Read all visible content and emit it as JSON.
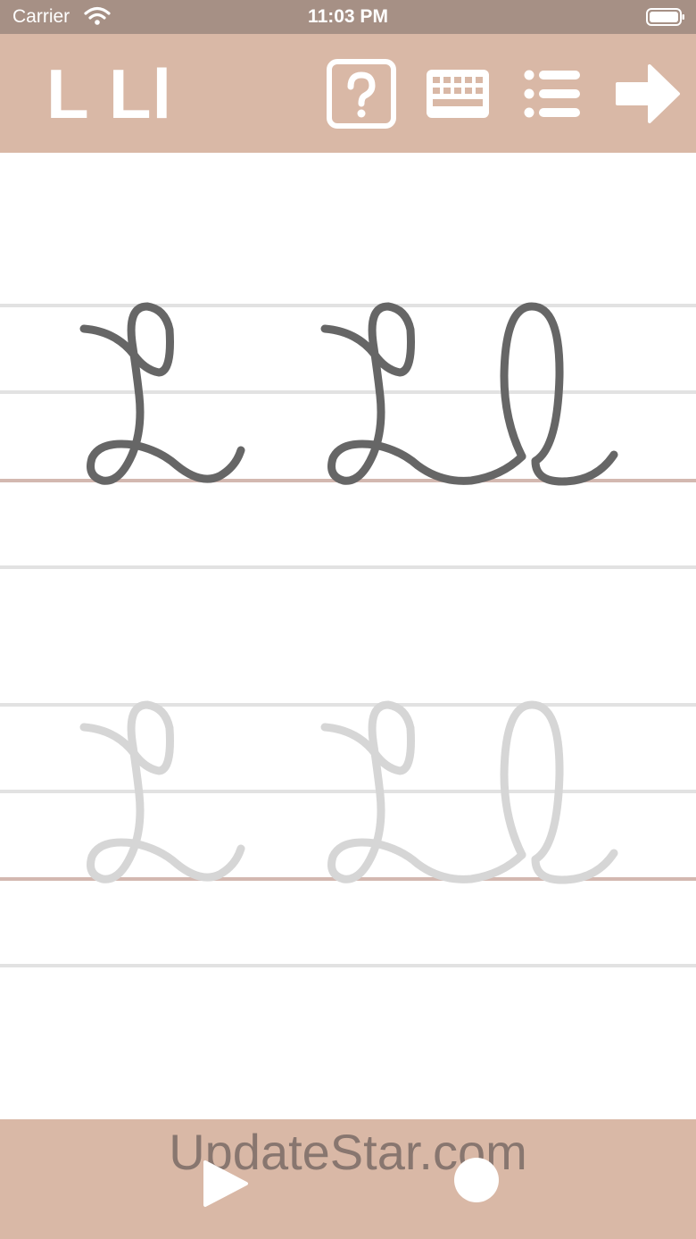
{
  "status_bar": {
    "carrier": "Carrier",
    "time": "11:03 PM"
  },
  "top_bar": {
    "title": "L Ll",
    "icons": [
      "help-icon",
      "keyboard-icon",
      "list-icon",
      "arrow-right-icon"
    ]
  },
  "practice": {
    "example_letters": "L Ll",
    "trace_letters": "L Ll",
    "colors": {
      "ink": "#666666",
      "trace": "#d6d6d6",
      "ruling": "#e2e2e2",
      "baseline": "#d3b8b0"
    }
  },
  "bottom_bar": {
    "watermark": "UpdateStar.com",
    "icons": [
      "play-icon",
      "record-icon"
    ]
  },
  "colors": {
    "status_bar": "#a69085",
    "toolbar": "#d9b8a6"
  }
}
